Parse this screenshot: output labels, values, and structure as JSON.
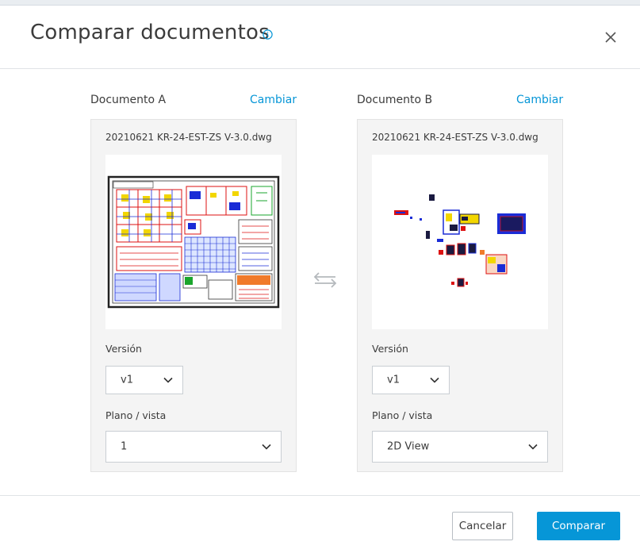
{
  "dialog": {
    "title": "Comparar documentos",
    "info_icon": "info-circle-icon",
    "close_icon": "close-icon",
    "swap_icon": "swap-arrows-icon"
  },
  "doc_a": {
    "heading": "Documento A",
    "change_label": "Cambiar",
    "file_name": "20210621 KR-24-EST-ZS V-3.0.dwg",
    "version_label": "Versión",
    "version_value": "v1",
    "sheet_label": "Plano / vista",
    "sheet_value": "1"
  },
  "doc_b": {
    "heading": "Documento B",
    "change_label": "Cambiar",
    "file_name": "20210621 KR-24-EST-ZS V-3.0.dwg",
    "version_label": "Versión",
    "version_value": "v1",
    "sheet_label": "Plano / vista",
    "sheet_value": "2D View"
  },
  "footer": {
    "cancel_label": "Cancelar",
    "compare_label": "Comparar"
  },
  "colors": {
    "accent": "#0696d7",
    "panel_bg": "#f4f4f4",
    "text": "#3c3c3c"
  }
}
